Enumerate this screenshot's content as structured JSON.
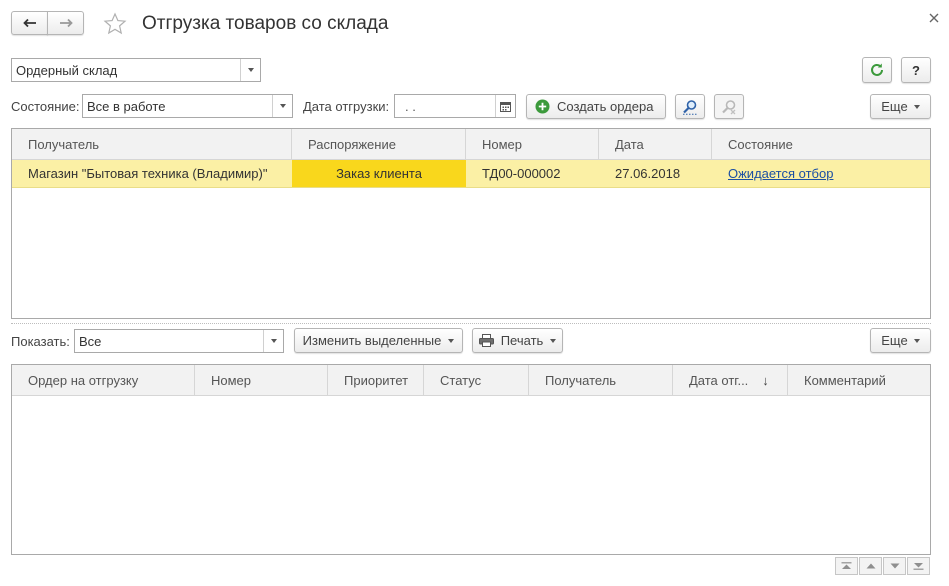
{
  "window": {
    "title": "Отгрузка товаров со склада"
  },
  "warehouse": {
    "value": "Ордерный склад"
  },
  "filters": {
    "state_label": "Состояние:",
    "state_value": "Все в работе",
    "date_label": "Дата отгрузки:",
    "date_value": ".   ."
  },
  "toolbar": {
    "create_orders_label": "Создать ордера",
    "more_label": "Еще",
    "refresh_tooltip": "refresh",
    "help_label": "?"
  },
  "top_table": {
    "columns": [
      "Получатель",
      "Распоряжение",
      "Номер",
      "Дата",
      "Состояние"
    ],
    "rows": [
      {
        "recipient": "Магазин \"Бытовая техника (Владимир)\"",
        "order": "Заказ клиента",
        "number": "ТД00-000002",
        "date": "27.06.2018",
        "state": "Ожидается отбор"
      }
    ]
  },
  "bottom_toolbar": {
    "show_label": "Показать:",
    "show_value": "Все",
    "change_selected_label": "Изменить выделенные",
    "print_label": "Печать",
    "more_label": "Еще"
  },
  "bottom_table": {
    "columns": [
      "Ордер на отгрузку",
      "Номер",
      "Приоритет",
      "Статус",
      "Получатель",
      "Дата отг...",
      "Комментарий"
    ],
    "sort_indicator": "↓"
  },
  "colors": {
    "highlight_row": "#fbf0a5",
    "highlight_cell": "#f9d71c",
    "accent_green": "#3c9a3c",
    "link": "#1b4fa3"
  }
}
